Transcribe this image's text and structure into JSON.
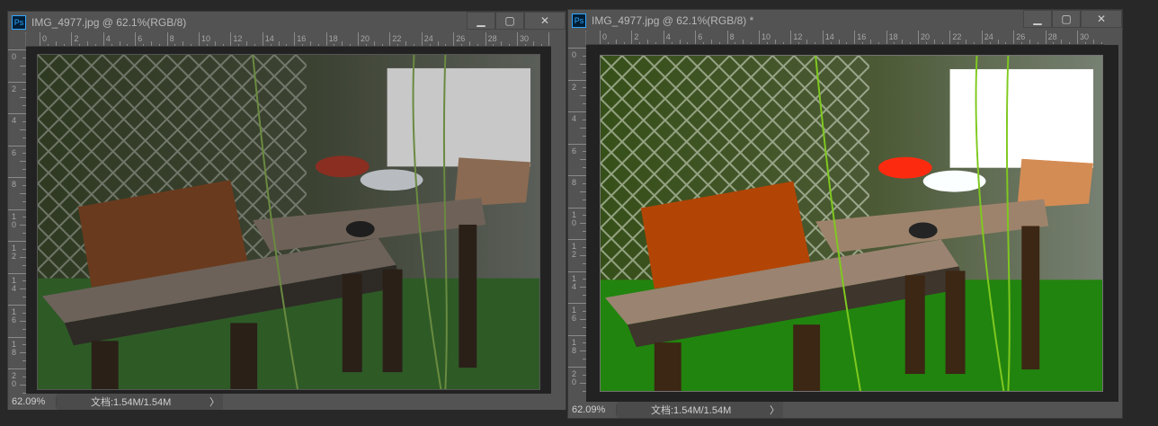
{
  "windows": [
    {
      "app_icon": "Ps",
      "title": "IMG_4977.jpg @ 62.1%(RGB/8)",
      "zoom": "62.09%",
      "doc_info": "文档:1.54M/1.54M",
      "arrow": "〉",
      "adjusted": false
    },
    {
      "app_icon": "Ps",
      "title": "IMG_4977.jpg @ 62.1%(RGB/8) *",
      "zoom": "62.09%",
      "doc_info": "文档:1.54M/1.54M",
      "arrow": "〉",
      "adjusted": true
    }
  ],
  "controls": {
    "minimize": "▁",
    "maximize": "▢",
    "close": "✕"
  },
  "ruler": {
    "h_labels": [
      "0",
      "2",
      "4",
      "6",
      "8",
      "10",
      "12",
      "14",
      "16",
      "18",
      "20",
      "22",
      "24",
      "26",
      "28",
      "30",
      "32"
    ],
    "v_labels": [
      "0",
      "2",
      "4",
      "6",
      "8",
      "10",
      "12",
      "14",
      "16",
      "18",
      "20"
    ]
  }
}
